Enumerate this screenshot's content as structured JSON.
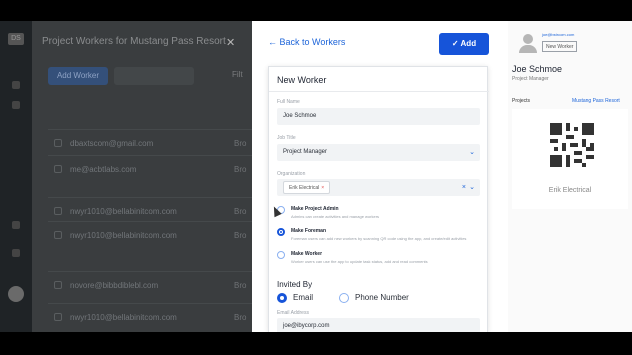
{
  "background": {
    "nav_logo": "DS",
    "title": "Project Workers for  Mustang Pass Resort",
    "close_icon": "✕",
    "add_worker_label": "Add Worker",
    "filter_label": "Filt",
    "rows": [
      {
        "email": "dbaxtscom@gmail.com",
        "b": "Bro"
      },
      {
        "email": "me@acbtlabs.com",
        "b": "Bro"
      },
      {
        "email": "nwyr1010@bellabinitcom.com",
        "b": "Bro"
      },
      {
        "email": "nwyr1010@bellabinitcom.com",
        "b": "Bro"
      },
      {
        "email": "novore@bibbdiblebl.com",
        "b": "Bro"
      },
      {
        "email": "nwyr1010@bellabinitcom.com",
        "b": "Bro"
      }
    ]
  },
  "drawer": {
    "back_label": "Back to Workers",
    "add_button_label": "Add",
    "card_title": "New Worker",
    "full_name_label": "Full Name",
    "full_name_value": "Joe Schmoe",
    "title_label": "Job Title",
    "title_value": "Project Manager",
    "org_label": "Organization",
    "org_chip": "Erik Electrical",
    "roles": [
      {
        "title": "Make Project Admin",
        "desc": "Admins can create activities and manage workers",
        "selected": false
      },
      {
        "title": "Make Foreman",
        "desc": "Foreman users can add new workers by scanning QR code using the app, and create/edit activities",
        "selected": true
      },
      {
        "title": "Make Worker",
        "desc": "Worker users can use the app to update task status, add and read comments",
        "selected": false
      }
    ],
    "invited_by_label": "Invited By",
    "invite_options": [
      {
        "label": "Email",
        "selected": true
      },
      {
        "label": "Phone Number",
        "selected": false
      }
    ],
    "email_label": "Email Address",
    "email_value": "joe@ibycorp.com"
  },
  "preview": {
    "email": "joe@bstrcom.com",
    "badge": "New Worker",
    "name": "Joe Schmoe",
    "role": "Project Manager",
    "projects_label": "Projects",
    "project_name": "Mustang Pass Resort",
    "company": "Erik Electrical"
  },
  "colors": {
    "accent": "#1654d9",
    "link": "#1c64d9"
  }
}
